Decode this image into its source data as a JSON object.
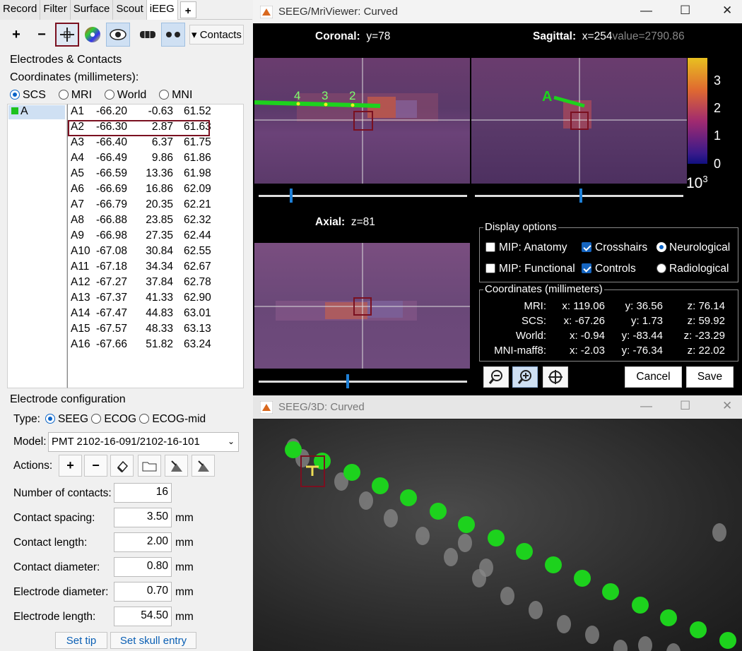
{
  "left": {
    "tabs": [
      "Record",
      "Filter",
      "Surface",
      "Scout",
      "iEEG",
      "+"
    ],
    "toolbar": {
      "add": "+",
      "remove": "−",
      "contacts_label": "▾ Contacts"
    },
    "group1_title": "Electrodes & Contacts",
    "coords_label": "Coordinates (millimeters):",
    "coord_systems": [
      "SCS",
      "MRI",
      "World",
      "MNI"
    ],
    "coord_selected": "SCS",
    "electrodes": [
      "A"
    ],
    "contacts": [
      {
        "name": "A1",
        "x": "-66.20",
        "y": "-0.63",
        "z": "61.52"
      },
      {
        "name": "A2",
        "x": "-66.30",
        "y": "2.87",
        "z": "61.63"
      },
      {
        "name": "A3",
        "x": "-66.40",
        "y": "6.37",
        "z": "61.75"
      },
      {
        "name": "A4",
        "x": "-66.49",
        "y": "9.86",
        "z": "61.86"
      },
      {
        "name": "A5",
        "x": "-66.59",
        "y": "13.36",
        "z": "61.98"
      },
      {
        "name": "A6",
        "x": "-66.69",
        "y": "16.86",
        "z": "62.09"
      },
      {
        "name": "A7",
        "x": "-66.79",
        "y": "20.35",
        "z": "62.21"
      },
      {
        "name": "A8",
        "x": "-66.88",
        "y": "23.85",
        "z": "62.32"
      },
      {
        "name": "A9",
        "x": "-66.98",
        "y": "27.35",
        "z": "62.44"
      },
      {
        "name": "A10",
        "x": "-67.08",
        "y": "30.84",
        "z": "62.55"
      },
      {
        "name": "A11",
        "x": "-67.18",
        "y": "34.34",
        "z": "62.67"
      },
      {
        "name": "A12",
        "x": "-67.27",
        "y": "37.84",
        "z": "62.78"
      },
      {
        "name": "A13",
        "x": "-67.37",
        "y": "41.33",
        "z": "62.90"
      },
      {
        "name": "A14",
        "x": "-67.47",
        "y": "44.83",
        "z": "63.01"
      },
      {
        "name": "A15",
        "x": "-67.57",
        "y": "48.33",
        "z": "63.13"
      },
      {
        "name": "A16",
        "x": "-67.66",
        "y": "51.82",
        "z": "63.24"
      }
    ],
    "config": {
      "title": "Electrode configuration",
      "type_label": "Type:",
      "types": [
        "SEEG",
        "ECOG",
        "ECOG-mid"
      ],
      "type_selected": "SEEG",
      "model_label": "Model:",
      "model_value": "PMT 2102-16-091/2102-16-101",
      "actions_label": "Actions:",
      "fields": [
        {
          "label": "Number of contacts:",
          "value": "16",
          "unit": ""
        },
        {
          "label": "Contact spacing:",
          "value": "3.50",
          "unit": "mm"
        },
        {
          "label": "Contact length:",
          "value": "2.00",
          "unit": "mm"
        },
        {
          "label": "Contact diameter:",
          "value": "0.80",
          "unit": "mm"
        },
        {
          "label": "Electrode diameter:",
          "value": "0.70",
          "unit": "mm"
        },
        {
          "label": "Electrode length:",
          "value": "54.50",
          "unit": "mm"
        }
      ],
      "set_tip": "Set tip",
      "set_skull": "Set skull entry"
    }
  },
  "mri": {
    "title": "SEEG/MriViewer: Curved",
    "coronal_label": "Coronal:",
    "coronal_val": "y=78",
    "sagittal_label": "Sagittal:",
    "sagittal_val": "x=254",
    "sagittal_extra": "value=2790.86",
    "axial_label": "Axial:",
    "axial_val": "z=81",
    "colorbar_ticks": [
      "3",
      "2",
      "1",
      "0"
    ],
    "colorbar_exp": "10",
    "colorbar_exp_sup": "3",
    "contact_labels": [
      "4",
      "3",
      "2"
    ],
    "electrode_label": "A",
    "display_title": "Display options",
    "opts": [
      {
        "label": "MIP: Anatomy",
        "kind": "chk",
        "on": false
      },
      {
        "label": "Crosshairs",
        "kind": "chk",
        "on": true
      },
      {
        "label": "Neurological",
        "kind": "radio",
        "on": true
      },
      {
        "label": "MIP: Functional",
        "kind": "chk",
        "on": false
      },
      {
        "label": "Controls",
        "kind": "chk",
        "on": true
      },
      {
        "label": "Radiological",
        "kind": "radio",
        "on": false
      }
    ],
    "coords_title": "Coordinates (millimeters)",
    "coords": [
      {
        "sys": "MRI:",
        "x": "x: 119.06",
        "y": "y: 36.56",
        "z": "z: 76.14"
      },
      {
        "sys": "SCS:",
        "x": "x: -67.26",
        "y": "y: 1.73",
        "z": "z: 59.92"
      },
      {
        "sys": "World:",
        "x": "x: -0.94",
        "y": "y: -83.44",
        "z": "z: -23.29"
      },
      {
        "sys": "MNI-maff8:",
        "x": "x: -2.03",
        "y": "y: -76.34",
        "z": "z: 22.02"
      }
    ],
    "cancel": "Cancel",
    "save": "Save",
    "sliders": {
      "coronal": 0.15,
      "sagittal": 0.5,
      "axial": 0.42
    }
  },
  "s3d": {
    "title": "SEEG/3D: Curved"
  }
}
